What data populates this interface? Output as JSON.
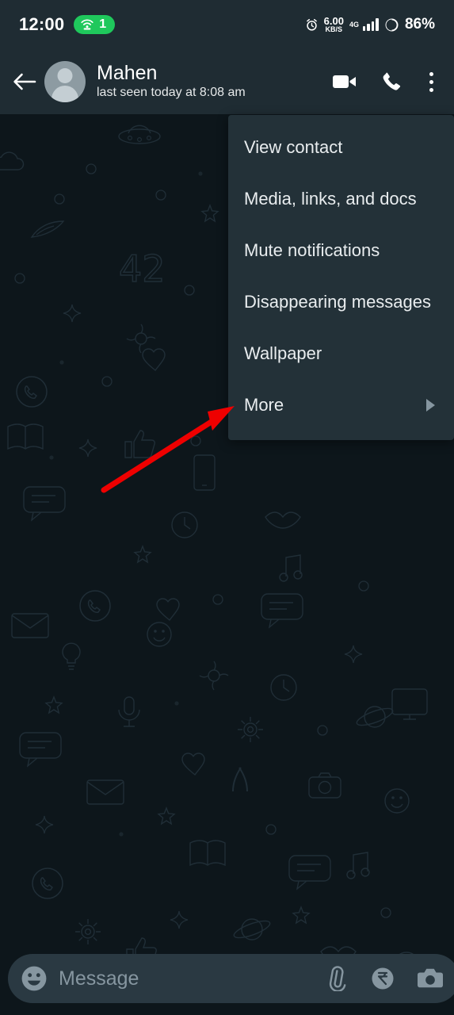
{
  "status_bar": {
    "time": "12:00",
    "hotspot_icon": "hotspot-icon",
    "hotspot_count": "1",
    "alarm_icon": "alarm-clock-icon",
    "net_speed_value": "6.00",
    "net_speed_unit": "KB/S",
    "network_type": "4G",
    "signal_icon": "signal-bars-icon",
    "battery_icon": "battery-circle-icon",
    "battery_percent": "86%"
  },
  "app_bar": {
    "back_icon": "back-arrow-icon",
    "avatar_icon": "default-avatar-icon",
    "contact_name": "Mahen",
    "contact_status": "last seen today at 8:08 am",
    "video_call_icon": "video-call-icon",
    "voice_call_icon": "phone-call-icon",
    "overflow_icon": "more-options-icon"
  },
  "overflow_menu": {
    "items": [
      {
        "label": "View contact",
        "name": "menu-item-view-contact",
        "has_submenu": false
      },
      {
        "label": "Media, links, and docs",
        "name": "menu-item-media-links-docs",
        "has_submenu": false
      },
      {
        "label": "Mute notifications",
        "name": "menu-item-mute-notifications",
        "has_submenu": false
      },
      {
        "label": "Disappearing messages",
        "name": "menu-item-disappearing-messages",
        "has_submenu": false
      },
      {
        "label": "Wallpaper",
        "name": "menu-item-wallpaper",
        "has_submenu": false
      },
      {
        "label": "More",
        "name": "menu-item-more",
        "has_submenu": true
      }
    ]
  },
  "annotation": {
    "arrow_color": "#ee0000",
    "points_to": "More"
  },
  "composer": {
    "emoji_icon": "emoji-icon",
    "placeholder": "Message",
    "value": "",
    "attach_icon": "attach-paperclip-icon",
    "payment_icon": "rupee-payment-icon",
    "camera_icon": "camera-icon",
    "mic_icon": "microphone-icon"
  },
  "theme": {
    "header_bg": "#1f2c33",
    "chat_bg": "#0d161b",
    "menu_bg": "#233138",
    "accent_green": "#00a884",
    "hotspot_green": "#1fc85c",
    "icon_grey": "#8696a0"
  }
}
